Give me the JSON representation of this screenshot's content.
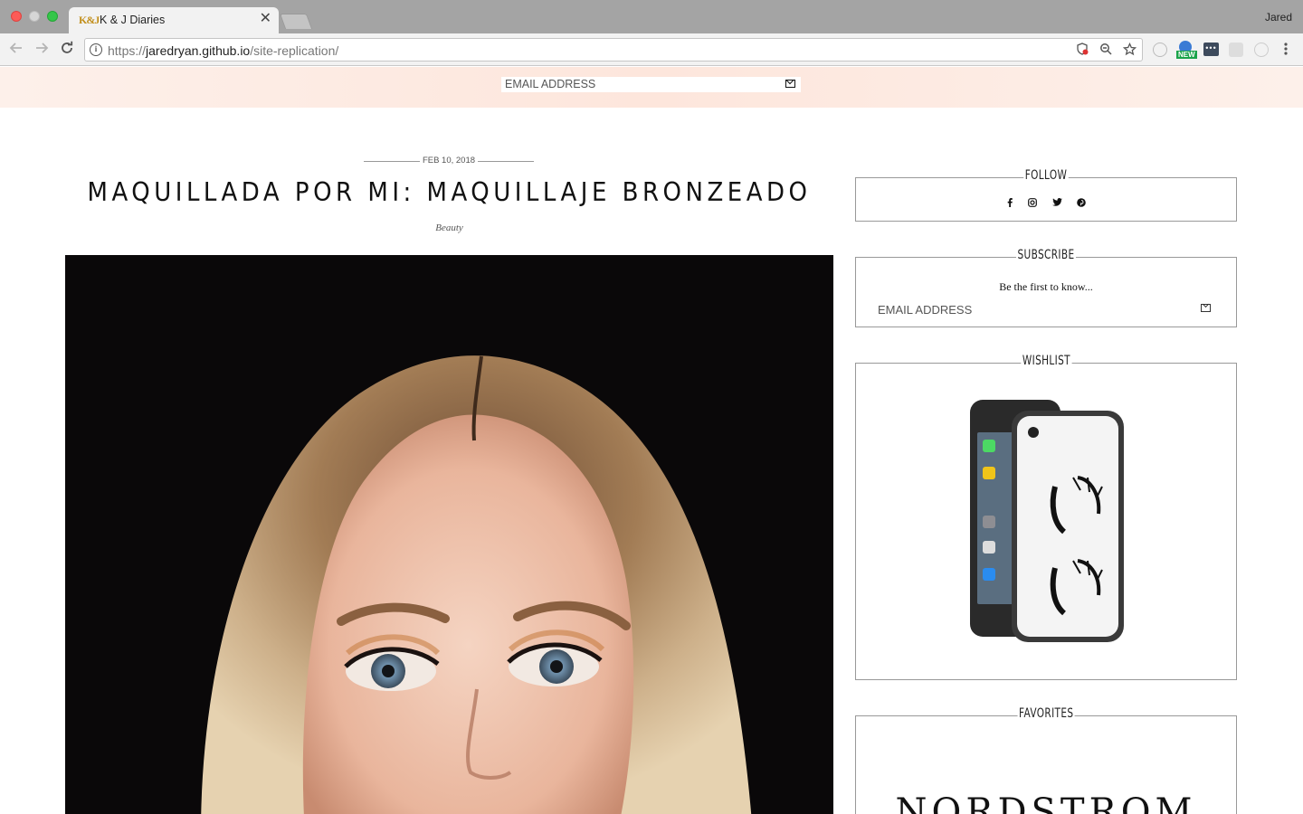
{
  "browser": {
    "tab_title": "K & J Diaries",
    "tab_favicon": "K&J",
    "close_glyph": "✕",
    "profile_name": "Jared",
    "url_scheme": "https://",
    "url_host": "jaredryan.github.io",
    "url_path": "/site-replication/",
    "new_badge": "NEW"
  },
  "header": {
    "email_placeholder": "EMAIL ADDRESS"
  },
  "post": {
    "date": "FEB 10, 2018",
    "title": "MAQUILLADA POR MI: MAQUILLAJE BRONZEADO",
    "category": "Beauty",
    "image": "hero-portrait"
  },
  "sidebar": {
    "follow": {
      "title": "FOLLOW",
      "icons": [
        "facebook-icon",
        "instagram-icon",
        "twitter-icon",
        "pinterest-icon"
      ]
    },
    "subscribe": {
      "title": "SUBSCRIBE",
      "tagline": "Be the first to know...",
      "email_placeholder": "EMAIL ADDRESS"
    },
    "wishlist": {
      "title": "WISHLIST",
      "item": "phone-case-image"
    },
    "favorites": {
      "title": "FAVORITES",
      "brand": "NORDSTROM"
    }
  },
  "colors": {
    "header_band": "#fde6dc",
    "hero_bg": "#0a0809"
  }
}
